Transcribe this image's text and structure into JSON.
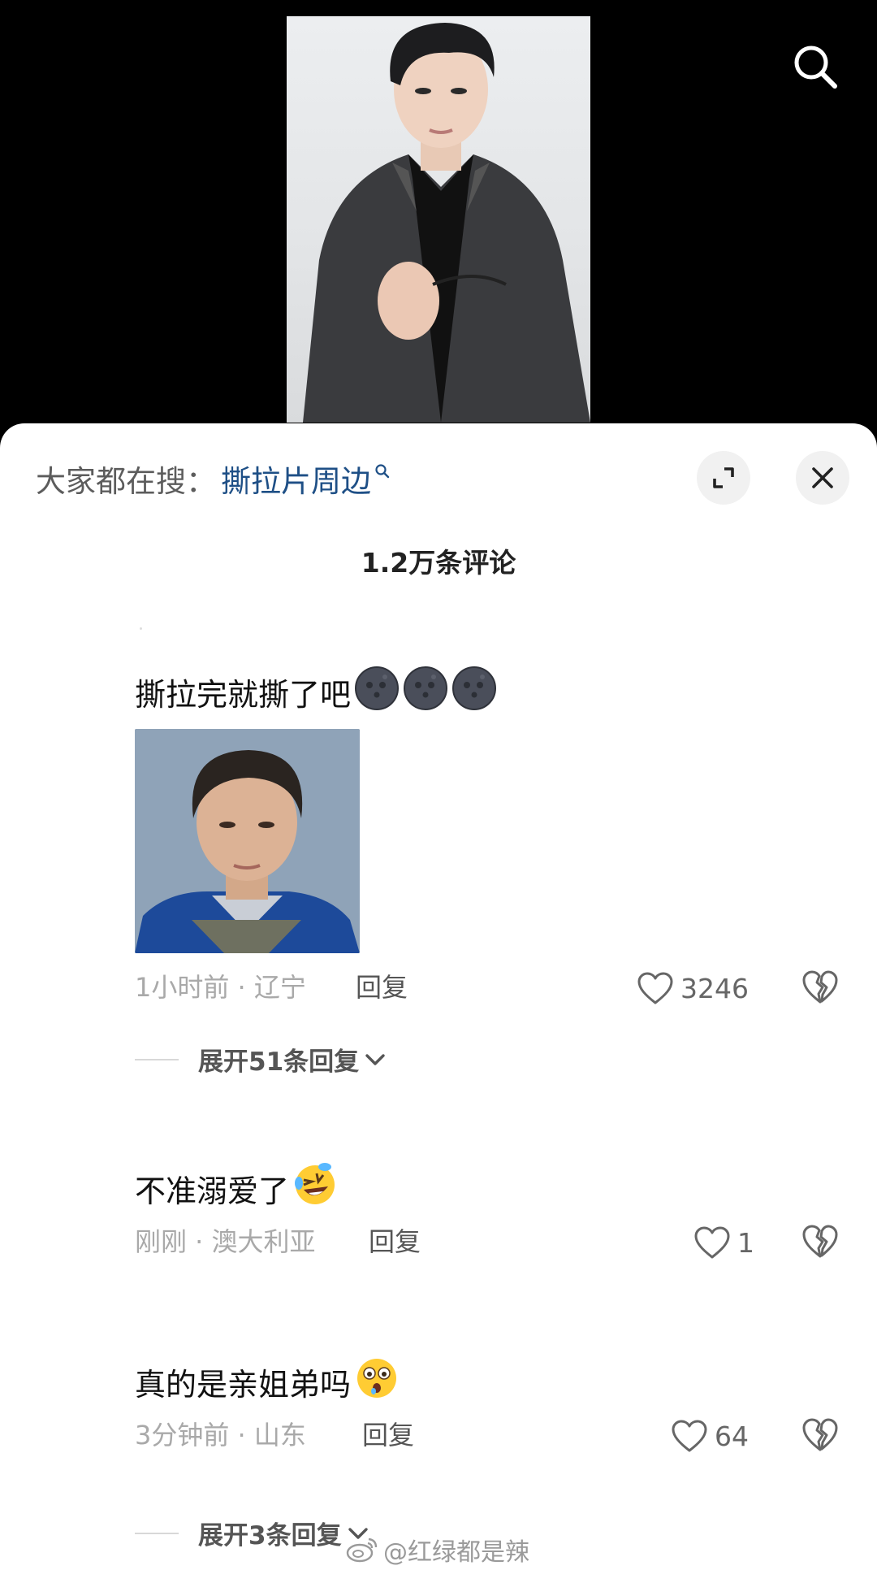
{
  "header": {
    "trending_prefix": "大家都在搜：",
    "trending_term": "撕拉片周边"
  },
  "comments_title": "1.2万条评论",
  "comments": [
    {
      "text": "撕拉完就撕了吧",
      "emojis": [
        "new-moon-face",
        "new-moon-face",
        "new-moon-face"
      ],
      "has_image": true,
      "meta": "1小时前 · 辽宁",
      "reply_label": "回复",
      "likes": "3246",
      "expand_label": "展开51条回复"
    },
    {
      "text": "不准溺爱了",
      "emojis": [
        "rolling-laughing-face"
      ],
      "has_image": false,
      "meta": "刚刚 · 澳大利亚",
      "reply_label": "回复",
      "likes": "1"
    },
    {
      "text": "真的是亲姐弟吗",
      "emojis": [
        "astonished-face"
      ],
      "has_image": false,
      "meta": "3分钟前 · 山东",
      "reply_label": "回复",
      "likes": "64",
      "expand_label": "展开3条回复"
    }
  ],
  "watermark": "@红绿都是辣",
  "colors": {
    "trending_term": "#1e4f86",
    "meta_gray": "#a9a9a9",
    "sheet_bg": "#ffffff",
    "video_bg": "#000000"
  },
  "icons": [
    "search-icon",
    "expand-icon",
    "close-icon",
    "heart-icon",
    "broken-heart-icon",
    "chevron-down-icon",
    "weibo-logo-icon"
  ]
}
